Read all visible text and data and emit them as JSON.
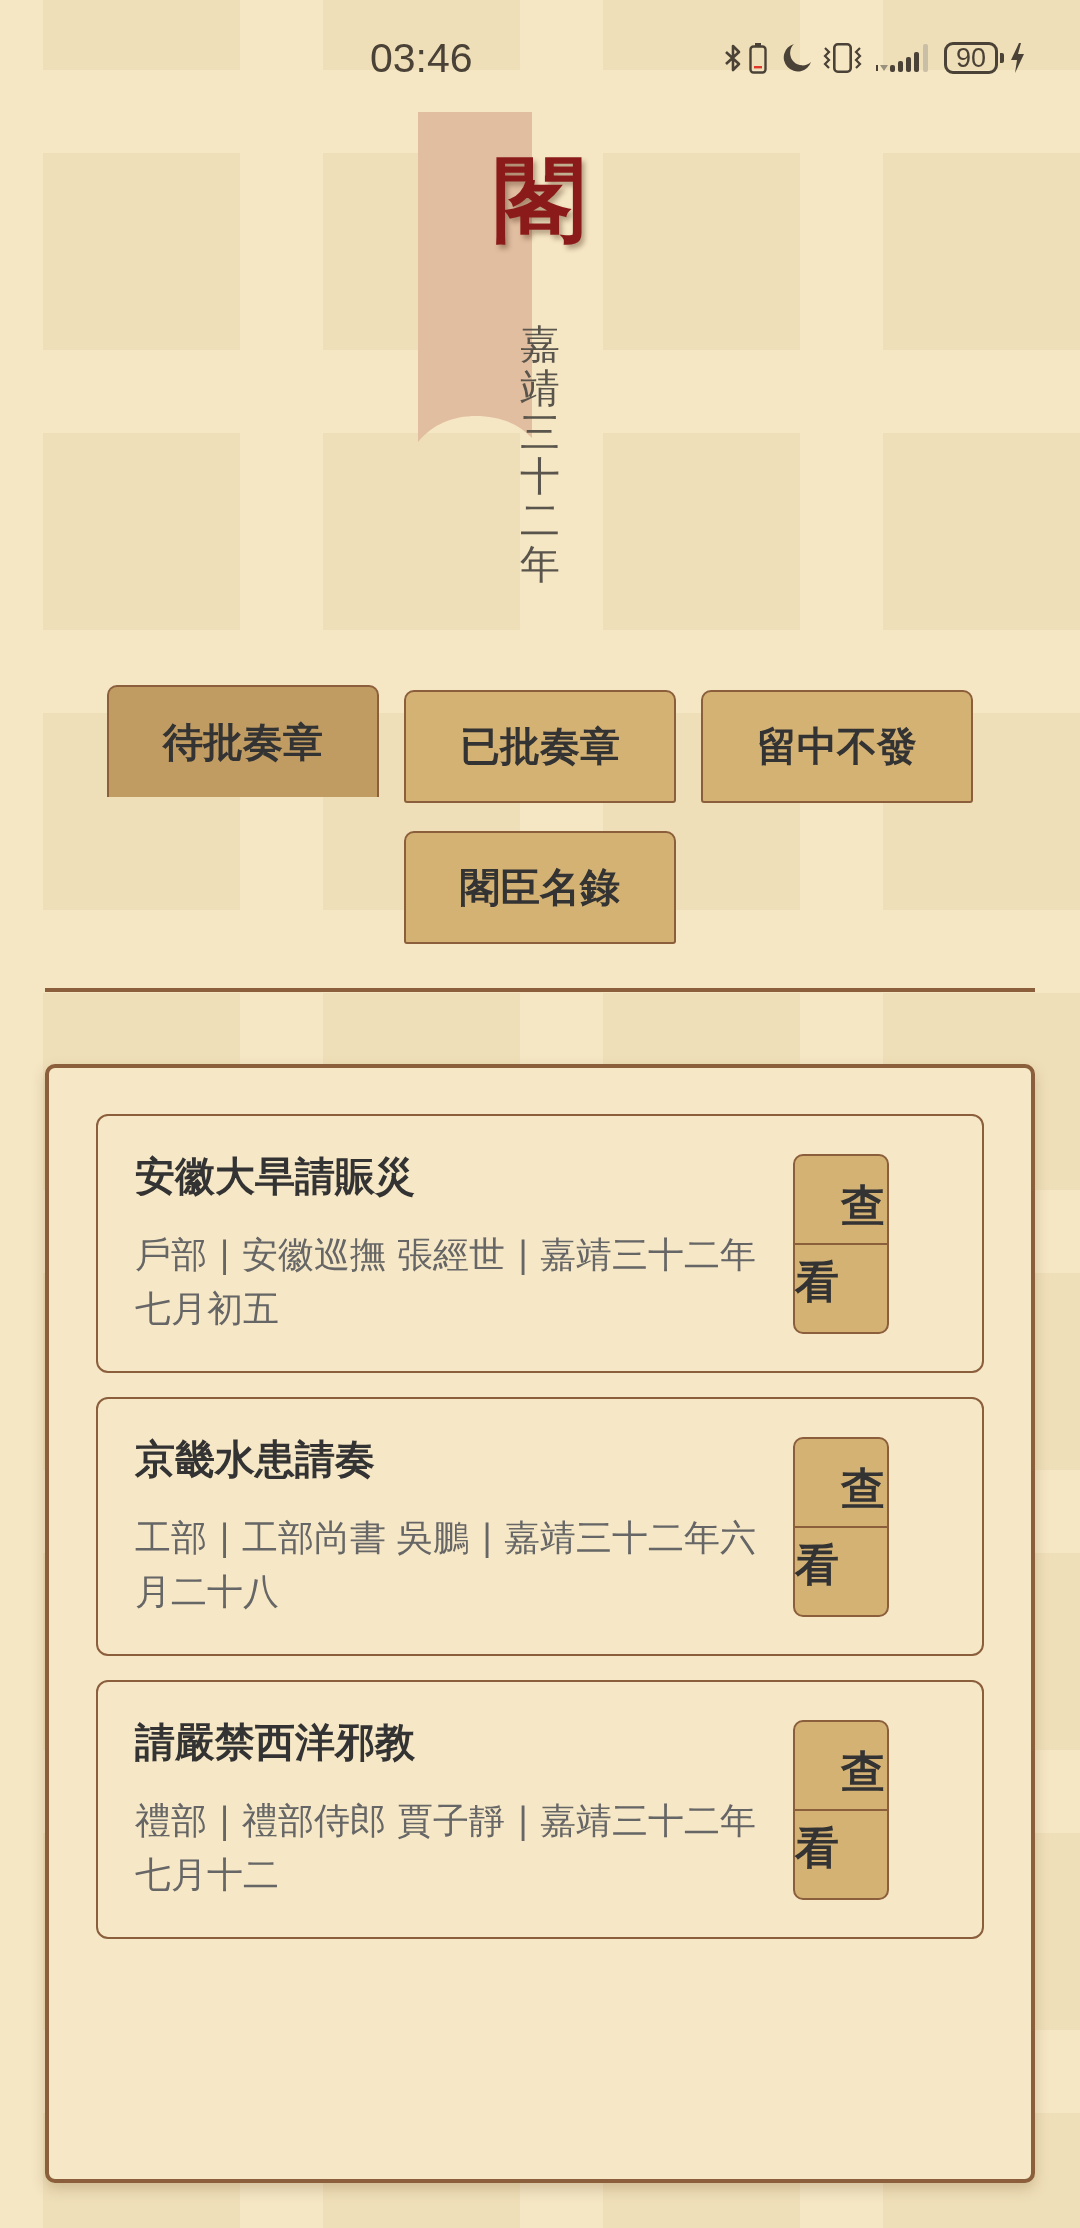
{
  "status_bar": {
    "time": "03:46",
    "battery": "90"
  },
  "header": {
    "title": "閣",
    "subtitle": "嘉靖三十二年"
  },
  "tabs": [
    {
      "label": "待批奏章",
      "selected": true
    },
    {
      "label": "已批奏章",
      "selected": false
    },
    {
      "label": "留中不發",
      "selected": false
    },
    {
      "label": "閣臣名錄",
      "selected": false
    }
  ],
  "memorials": [
    {
      "title": "安徽大旱請賑災",
      "meta": "戶部 | 安徽巡撫 張經世 | 嘉靖三十二年七月初五",
      "action": "查看"
    },
    {
      "title": "京畿水患請奏",
      "meta": "工部 | 工部尚書 吳鵬 | 嘉靖三十二年六月二十八",
      "action": "查看"
    },
    {
      "title": "請嚴禁西洋邪教",
      "meta": "禮部 | 禮部侍郎 賈子靜 | 嘉靖三十二年七月十二",
      "action": "查看"
    }
  ]
}
